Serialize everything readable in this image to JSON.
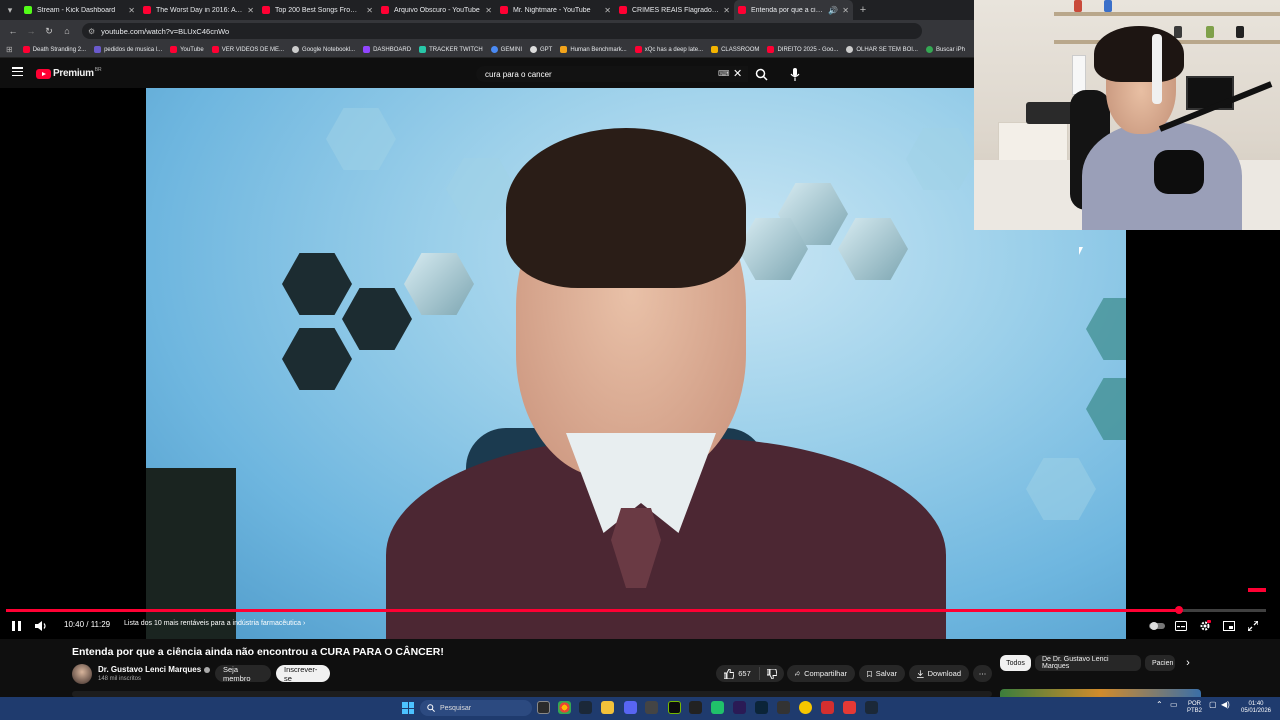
{
  "browser": {
    "tabs": [
      {
        "title": "Stream - Kick Dashboard",
        "icon": "kick-icon",
        "color": "#53fc18"
      },
      {
        "title": "The Worst Day in 2016: A Playli",
        "icon": "youtube-icon",
        "color": "#ff0033"
      },
      {
        "title": "Top 200 Best Songs From 2010",
        "icon": "youtube-icon",
        "color": "#ff0033"
      },
      {
        "title": "Arquivo Obscuro - YouTube",
        "icon": "youtube-icon",
        "color": "#ff0033"
      },
      {
        "title": "Mr. Nightmare - YouTube",
        "icon": "youtube-icon",
        "color": "#ff0033"
      },
      {
        "title": "CRIMES REAIS Flagrados Pelo C",
        "icon": "youtube-icon",
        "color": "#ff0033"
      },
      {
        "title": "Entenda por que a ciência",
        "icon": "youtube-icon",
        "color": "#ff0033",
        "active": true
      }
    ],
    "url": "youtube.com/watch?v=BLUxC46cnWo",
    "bookmarks": [
      "Death Stranding 2...",
      "pedidos de musica l...",
      "YouTube",
      "VER VIDEOS DE ME...",
      "Google Notebookl...",
      "DASHBOARD",
      "TRACKER TWITCH",
      "GEMINI",
      "GPT",
      "Human Benchmark...",
      "xQc has a deep late...",
      "CLASSROOM",
      "DIREITO 2025 - Goo...",
      "OLHAR SE TEM BOI...",
      "Buscar iPh"
    ]
  },
  "youtube": {
    "logo_text": "Premium",
    "logo_region": "BR",
    "search_value": "cura para o cancer",
    "player": {
      "time": "10:40 / 11:29",
      "chapter": "Lista dos 10 mais rentáveis para a indústria farmacêutica",
      "progress": 0.931
    },
    "video": {
      "title": "Entenda por que a ciência ainda não encontrou a CURA PARA O CÂNCER!",
      "channel": "Dr. Gustavo Lenci Marques",
      "subscribers": "148 mil inscritos",
      "join_label": "Seja membro",
      "subscribe_label": "Inscrever-se",
      "likes": "657",
      "share_label": "Compartilhar",
      "save_label": "Salvar",
      "download_label": "Download"
    },
    "chips": [
      "Todos",
      "De Dr. Gustavo Lenci Marques",
      "Pacien"
    ]
  },
  "taskbar": {
    "search_placeholder": "Pesquisar",
    "lang_top": "POR",
    "lang_bottom": "PTB2",
    "time": "01:40",
    "date": "05/01/2026"
  },
  "colors": {
    "accent": "#ff0033",
    "background": "#0f0f0f",
    "taskbar": "#1f3b6e"
  }
}
